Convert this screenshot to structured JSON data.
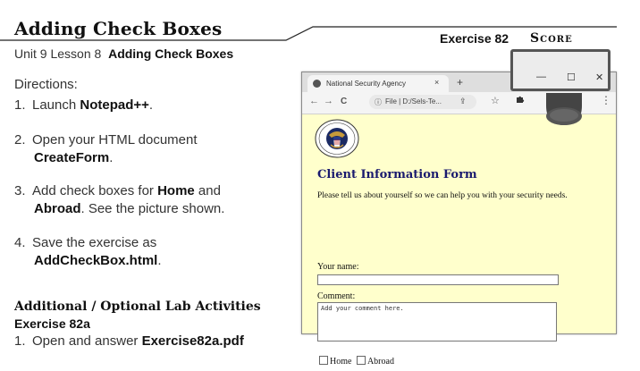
{
  "header": {
    "title": "Adding Check Boxes",
    "exercise": "Exercise 82",
    "score": "Score",
    "unit_prefix": "Unit 9 Lesson 8",
    "unit_title": "Adding Check Boxes"
  },
  "directions": {
    "label": "Directions:",
    "steps": [
      {
        "num": "1.",
        "pre": "Launch ",
        "bold": "Notepad++",
        "post": ".",
        "line2": ""
      },
      {
        "num": "2.",
        "pre": "Open your HTML document",
        "bold": "CreateForm",
        "post": ".",
        "line2": ""
      },
      {
        "num": "3.",
        "pre": "Add check boxes for ",
        "bold": "Home",
        "post": " and",
        "bold2": "Abroad",
        "post2": ". See the picture shown."
      },
      {
        "num": "4.",
        "pre": "Save the exercise as",
        "bold": "AddCheckBox.html",
        "post": "."
      }
    ]
  },
  "additional": {
    "heading": "Additional / Optional Lab Activities",
    "exercise": "Exercise 82a",
    "step_num": "1.",
    "step_pre": "Open and answer ",
    "step_bold": "Exercise82a.pdf"
  },
  "browser": {
    "tab_title": "National Security Agency",
    "tab_close": "×",
    "new_tab": "+",
    "back": "←",
    "forward": "→",
    "reload": "C",
    "info": "ⓘ",
    "address": "File  |  D:/Sels-Te...",
    "share": "⇪",
    "star": "☆",
    "menu": "⋮",
    "form": {
      "title": "Client Information Form",
      "description": "Please tell us about yourself so we can help you with your security needs.",
      "name_label": "Your name:",
      "comment_label": "Comment:",
      "comment_value": "Add your comment here.",
      "checkbox_home": "Home",
      "checkbox_abroad": "Abroad"
    }
  },
  "window_controls": {
    "minimize": "—",
    "maximize": "☐",
    "close": "✕"
  },
  "colors": {
    "page_bg": "#ffffcc",
    "form_title": "#1a1a6e"
  }
}
